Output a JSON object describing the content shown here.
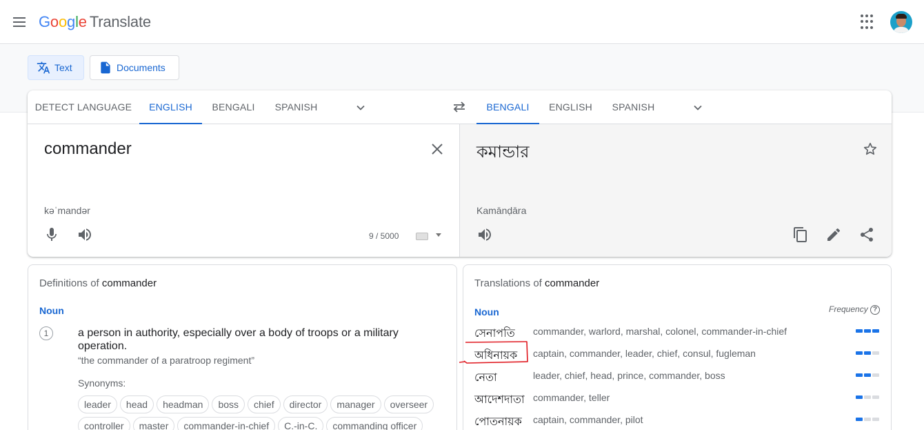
{
  "header": {
    "logo_letters": [
      "G",
      "o",
      "o",
      "g",
      "l",
      "e"
    ],
    "product": "Translate",
    "menu_icon": "hamburger-menu-icon",
    "apps_icon": "apps-grid-icon"
  },
  "modes": [
    {
      "label": "Text",
      "icon": "translate-icon",
      "active": true
    },
    {
      "label": "Documents",
      "icon": "document-icon",
      "active": false
    }
  ],
  "source_langs": [
    "DETECT LANGUAGE",
    "ENGLISH",
    "BENGALI",
    "SPANISH"
  ],
  "source_active": "ENGLISH",
  "target_langs": [
    "BENGALI",
    "ENGLISH",
    "SPANISH"
  ],
  "target_active": "BENGALI",
  "source": {
    "text": "commander",
    "phonetic": "kəˈmandər",
    "char_count": "9 / 5000"
  },
  "target": {
    "text": "কমান্ডার",
    "transliteration": "Kamānḍāra"
  },
  "definitions": {
    "title_prefix": "Definitions of ",
    "term": "commander",
    "pos": "Noun",
    "items": [
      {
        "num": "1",
        "text": "a person in authority, especially over a body of troops or a military operation.",
        "example": "“the commander of a paratroop regiment”",
        "synonyms_label": "Synonyms:",
        "synonyms": [
          "leader",
          "head",
          "headman",
          "boss",
          "chief",
          "director",
          "manager",
          "overseer",
          "controller",
          "master",
          "commander-in-chief",
          "C.-in-C.",
          "commanding officer"
        ]
      }
    ]
  },
  "translations": {
    "title_prefix": "Translations of ",
    "term": "commander",
    "pos": "Noun",
    "freq_label": "Frequency",
    "rows": [
      {
        "word": "সেনাপতি",
        "reverse": "commander, warlord, marshal, colonel, commander-in-chief",
        "frequency": 3
      },
      {
        "word": "অধিনায়ক",
        "reverse": "captain, commander, leader, chief, consul, fugleman",
        "frequency": 2
      },
      {
        "word": "নেতা",
        "reverse": "leader, chief, head, prince, commander, boss",
        "frequency": 2
      },
      {
        "word": "আদেশদাতা",
        "reverse": "commander, teller",
        "frequency": 1
      },
      {
        "word": "পোতনায়ক",
        "reverse": "captain, commander, pilot",
        "frequency": 1
      }
    ],
    "highlighted_row": 1
  },
  "colors": {
    "accent": "#1967d2",
    "freq_on": "#1a73e8",
    "freq_off": "#dadce0",
    "annotation": "#e0181f"
  }
}
